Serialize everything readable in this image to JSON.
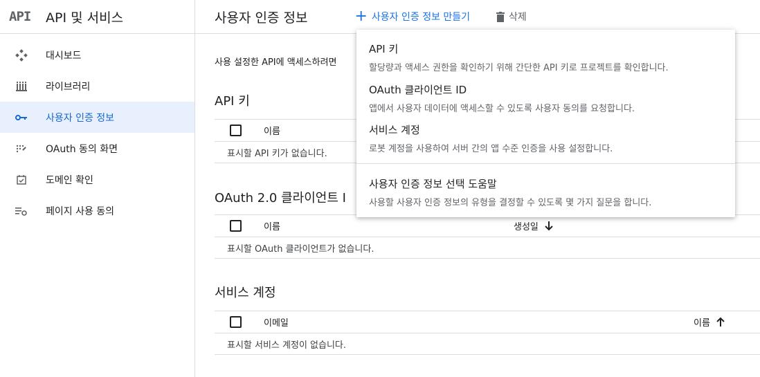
{
  "sidebar": {
    "logo": "API",
    "title": "API 및 서비스",
    "items": [
      {
        "label": "대시보드",
        "icon": "dashboard-icon"
      },
      {
        "label": "라이브러리",
        "icon": "library-icon"
      },
      {
        "label": "사용자 인증 정보",
        "icon": "key-icon",
        "active": true
      },
      {
        "label": "OAuth 동의 화면",
        "icon": "consent-icon"
      },
      {
        "label": "도메인 확인",
        "icon": "domain-check-icon"
      },
      {
        "label": "페이지 사용 동의",
        "icon": "settings-list-icon"
      }
    ]
  },
  "header": {
    "title": "사용자 인증 정보",
    "create_label": "사용자 인증 정보 만들기",
    "delete_label": "삭제"
  },
  "main": {
    "intro": "사용 설정한 API에 액세스하려면",
    "api_keys": {
      "title": "API 키",
      "col_name": "이름",
      "empty": "표시할 API 키가 없습니다."
    },
    "oauth": {
      "title": "OAuth 2.0 클라이언트 I",
      "col_name": "이름",
      "col_created": "생성일",
      "empty": "표시할 OAuth 클라이언트가 없습니다."
    },
    "service_accounts": {
      "title": "서비스 계정",
      "col_email": "이메일",
      "col_name": "이름",
      "empty": "표시할 서비스 계정이 없습니다."
    }
  },
  "menu": {
    "items": [
      {
        "title": "API 키",
        "desc": "할당량과 액세스 권한을 확인하기 위해 간단한 API 키로 프로젝트를 확인합니다."
      },
      {
        "title": "OAuth 클라이언트 ID",
        "desc": "앱에서 사용자 데이터에 액세스할 수 있도록 사용자 동의를 요청합니다."
      },
      {
        "title": "서비스 계정",
        "desc": "로봇 계정을 사용하여 서버 간의 앱 수준 인증을 사용 설정합니다."
      },
      {
        "title": "사용자 인증 정보 선택 도움말",
        "desc": "사용할 사용자 인증 정보의 유형을 결정할 수 있도록 몇 가지 질문을 합니다."
      }
    ]
  },
  "colors": {
    "accent": "#1a73e8",
    "active_bg": "#e8f0fe",
    "border": "#dadce0"
  }
}
